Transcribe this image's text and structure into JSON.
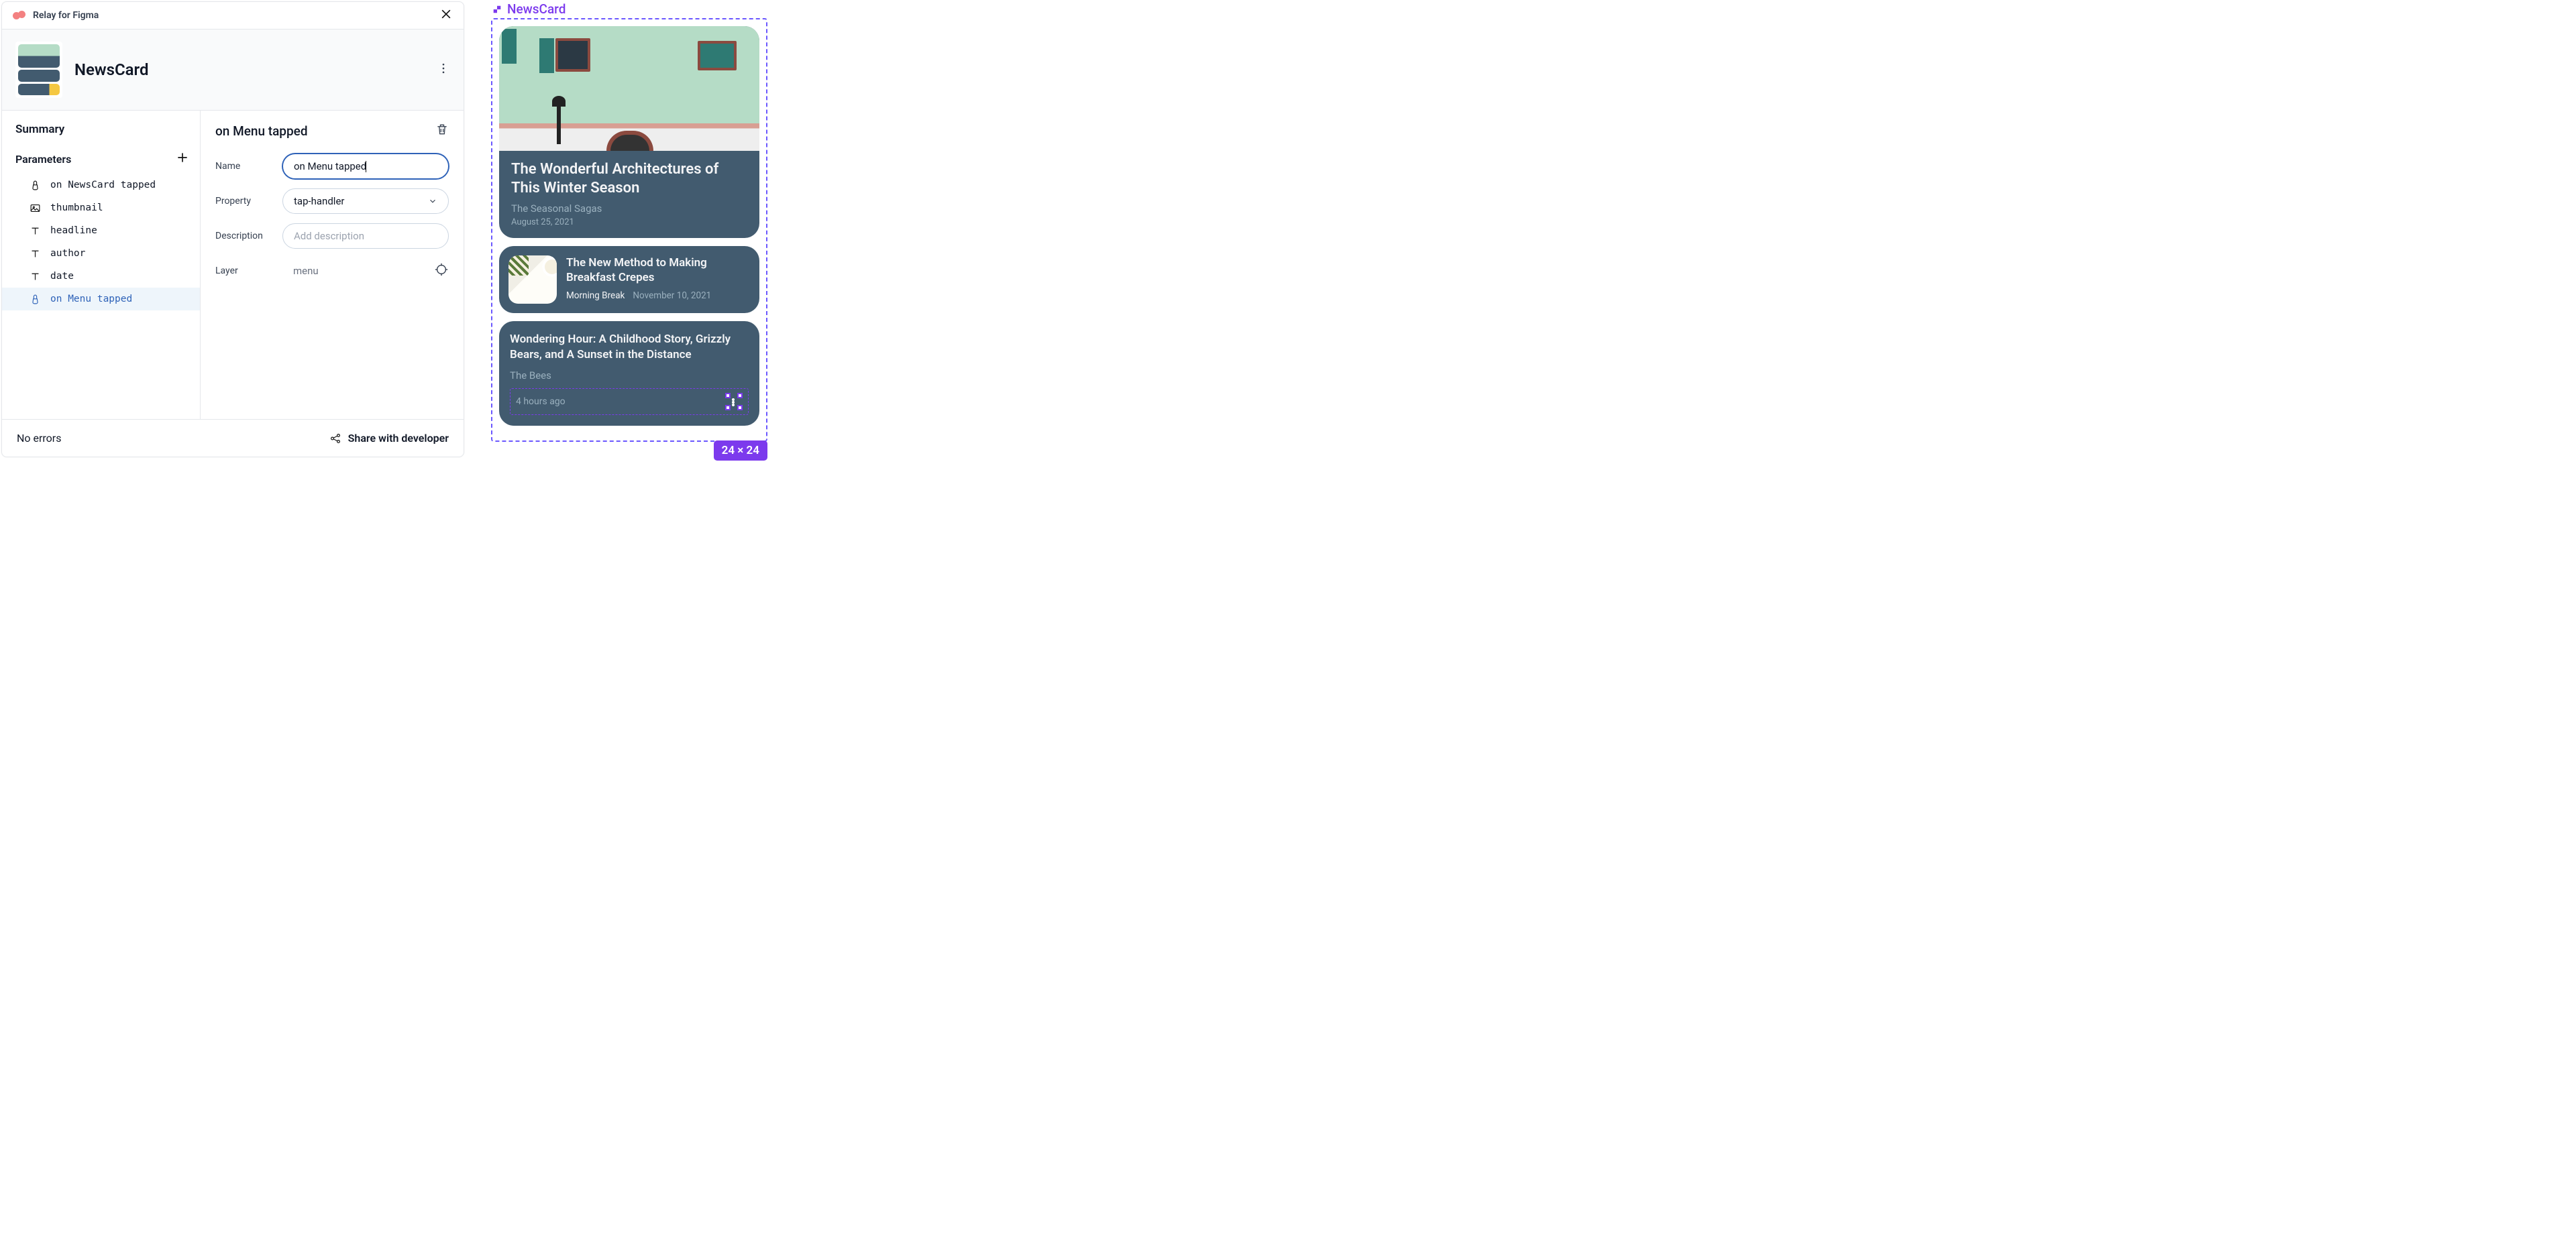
{
  "panel": {
    "brand": "Relay for Figma",
    "title": "NewsCard",
    "summary_heading": "Summary",
    "parameters_heading": "Parameters",
    "params": [
      {
        "icon": "tap",
        "label": "on NewsCard tapped"
      },
      {
        "icon": "image",
        "label": "thumbnail"
      },
      {
        "icon": "text",
        "label": "headline"
      },
      {
        "icon": "text",
        "label": "author"
      },
      {
        "icon": "text",
        "label": "date"
      },
      {
        "icon": "tap",
        "label": "on Menu tapped",
        "selected": true
      }
    ],
    "detail": {
      "title": "on Menu tapped",
      "fields": {
        "name_label": "Name",
        "name_value": "on Menu tapped",
        "property_label": "Property",
        "property_value": "tap-handler",
        "description_label": "Description",
        "description_placeholder": "Add description",
        "layer_label": "Layer",
        "layer_value": "menu"
      }
    },
    "footer": {
      "errors": "No errors",
      "share": "Share with developer"
    }
  },
  "preview": {
    "label": "NewsCard",
    "dim_badge": "24 × 24",
    "cards": [
      {
        "headline": "The Wonderful Architectures of This Winter Season",
        "source": "The Seasonal Sagas",
        "date": "August 25, 2021"
      },
      {
        "headline": "The New Method to Making Breakfast Crepes",
        "source": "Morning Break",
        "date": "November 10, 2021"
      },
      {
        "headline": "Wondering Hour: A Childhood Story, Grizzly Bears, and A Sunset in the Distance",
        "source": "The Bees",
        "date": "4 hours ago"
      }
    ]
  }
}
